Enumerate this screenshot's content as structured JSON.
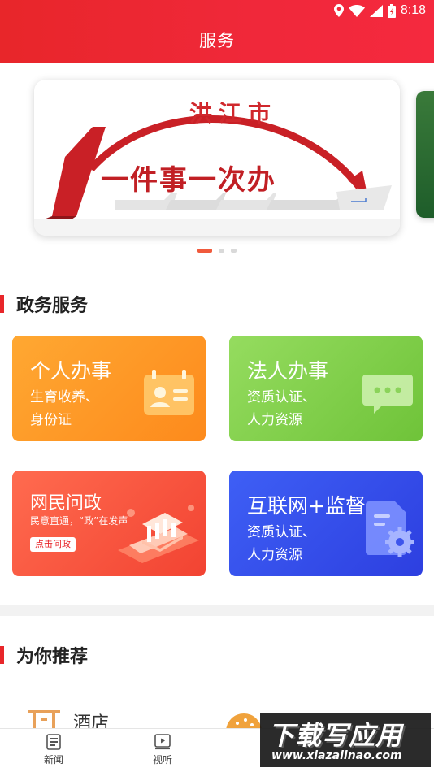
{
  "status_bar": {
    "time": "8:18"
  },
  "header": {
    "title": "服务"
  },
  "banner": {
    "city": "洪江市",
    "slogan": "一件事一次办",
    "slide_count": 3,
    "active_slide": 1
  },
  "gov_section": {
    "title": "政务服务"
  },
  "services": [
    {
      "title": "个人办事",
      "lines": [
        "生育收养、",
        "身份证"
      ],
      "icon": "personal-id-card-icon",
      "color": "#fd961f"
    },
    {
      "title": "法人办事",
      "lines": [
        "资质认证、",
        "人力资源"
      ],
      "icon": "chat-bubble-icon",
      "color": "#7fcf47"
    },
    {
      "title": "网民问政",
      "lines": [
        "民意直通，“政”在发声"
      ],
      "button": "点击问政",
      "icon": "government-building-icon",
      "color": "#f5503a"
    },
    {
      "title": "互联网+监督",
      "lines": [
        "资质认证、",
        "人力资源"
      ],
      "icon": "document-gear-icon",
      "color": "#3350ea"
    }
  ],
  "recommend_section": {
    "title": "为你推荐",
    "items": [
      {
        "label": "酒店",
        "icon": "hotel-icon"
      }
    ]
  },
  "bottom_nav": [
    {
      "label": "新闻",
      "icon": "news-icon"
    },
    {
      "label": "视听",
      "icon": "video-icon"
    }
  ],
  "watermark": {
    "big": "下载写应用",
    "small": "www.xiazaiinao.com"
  },
  "colors": {
    "primary": "#e8262a",
    "section_bar": "#e8262a"
  }
}
